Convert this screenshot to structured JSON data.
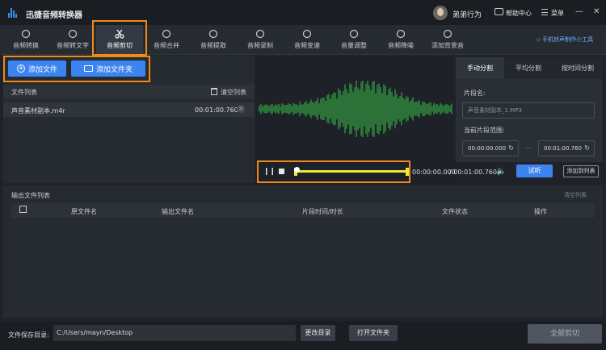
{
  "app": {
    "title": "迅捷音频转换器"
  },
  "titlebar": {
    "username": "弟弟行为",
    "help": "帮助中心",
    "menu": "菜单",
    "minimize": "—",
    "close": "✕"
  },
  "toolbar": {
    "tools": [
      {
        "label": "音频转换",
        "icon": "refresh-icon"
      },
      {
        "label": "音频转文字",
        "icon": "audio-to-text-icon"
      },
      {
        "label": "音频剪切",
        "icon": "scissors-icon",
        "active": true
      },
      {
        "label": "音频合并",
        "icon": "merge-icon"
      },
      {
        "label": "音频提取",
        "icon": "extract-icon"
      },
      {
        "label": "音频录制",
        "icon": "microphone-icon"
      },
      {
        "label": "音频变速",
        "icon": "speed-icon"
      },
      {
        "label": "音量调整",
        "icon": "volume-icon"
      },
      {
        "label": "音频降噪",
        "icon": "denoise-icon"
      },
      {
        "label": "添加背景音",
        "icon": "background-music-icon"
      }
    ],
    "promo": "手机铃声制作小工具"
  },
  "file_panel": {
    "add_file": "添加文件",
    "add_folder": "添加文件夹",
    "list_title": "文件列表",
    "clear_list": "清空列表",
    "files": [
      {
        "name": "声音素材副本.m4r",
        "duration": "00:01:00.760"
      }
    ]
  },
  "player": {
    "current_time": "00:00:00.000",
    "total_time": "/ 00:01:00.760",
    "progress": 0.0,
    "listen": "试听",
    "add_to_list": "添加到列表"
  },
  "split": {
    "tabs": [
      "手动分割",
      "平均分割",
      "按时间分割"
    ],
    "active_tab": 0,
    "segment_name_label": "片段名:",
    "segment_name_placeholder": "声音素材副本_1.MP3",
    "range_label": "当前片段范围:",
    "range_start": "00:00:00.000",
    "range_sep": "—",
    "range_end": "00:01:00.760"
  },
  "output": {
    "title": "输出文件列表",
    "clear": "清空列表",
    "columns": [
      "原文件名",
      "输出文件名",
      "片段时间/时长",
      "文件状态",
      "操作"
    ]
  },
  "bottom": {
    "save_label": "文件保存目录:",
    "save_path": "C:/Users/mayn/Desktop",
    "change_dir": "更改目录",
    "open_folder": "打开文件夹",
    "cut_all": "全部剪切"
  },
  "colors": {
    "accent": "#3c84f0",
    "highlight": "#f28a1a",
    "wave": "#39c049",
    "track": "#e8f033"
  }
}
